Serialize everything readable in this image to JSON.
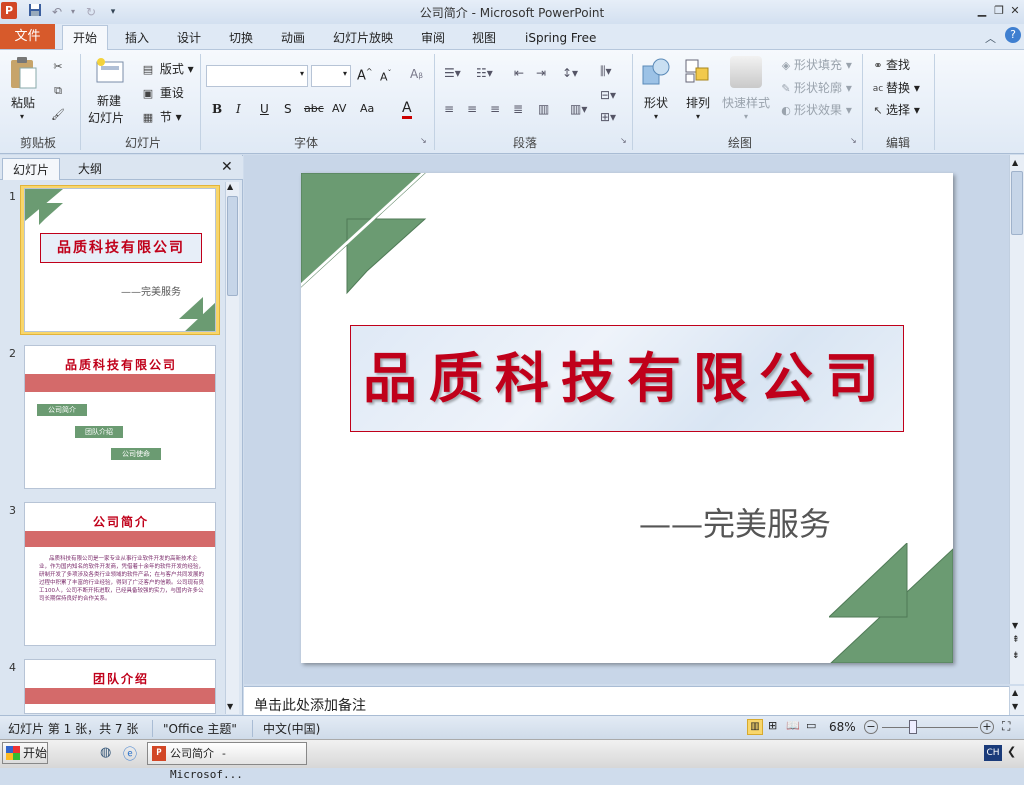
{
  "window": {
    "title": "公司简介 - Microsoft PowerPoint",
    "app_logo": "P"
  },
  "quick_access": {
    "save_icon": "save-icon",
    "undo_icon": "undo-icon",
    "redo_icon": "redo-icon"
  },
  "tabs": [
    "文件",
    "开始",
    "插入",
    "设计",
    "切换",
    "动画",
    "幻灯片放映",
    "审阅",
    "视图",
    "iSpring Free"
  ],
  "ribbon": {
    "clipboard": {
      "paste": "粘贴",
      "label": "剪贴板"
    },
    "slides": {
      "new_slide_1": "新建",
      "new_slide_2": "幻灯片",
      "layout": "版式",
      "reset": "重设",
      "section": "节",
      "label": "幻灯片"
    },
    "font": {
      "label": "字体",
      "bold": "B",
      "italic": "I",
      "underline": "U",
      "shadow": "S",
      "strike": "abc",
      "spacing": "AV",
      "case": "Aa",
      "color": "A"
    },
    "paragraph": {
      "label": "段落"
    },
    "drawing": {
      "shapes": "形状",
      "arrange": "排列",
      "quick_styles": "快速样式",
      "fill": "形状填充",
      "outline": "形状轮廓",
      "effects": "形状效果",
      "label": "绘图"
    },
    "editing": {
      "find": "查找",
      "replace": "替换",
      "select": "选择",
      "label": "编辑"
    }
  },
  "left_panel": {
    "tab_slides": "幻灯片",
    "tab_outline": "大纲",
    "thumbnails": [
      {
        "num": "1",
        "title": "品质科技有限公司",
        "subtitle": "——完美服务"
      },
      {
        "num": "2",
        "title": "品质科技有限公司",
        "items": [
          "公司简介",
          "团队介绍",
          "公司使命"
        ]
      },
      {
        "num": "3",
        "title": "公司简介",
        "body": "品质科技有限公司是一家专业从事行业软件开发的高新技术企业，作为国内知名的软件开发商，凭借着十余年的软件开发的经验，研制开发了多项涉及各类行业领域的软件产品；在与客户共同发展的过程中积累了丰富的行业经验，得到了广泛客户的信赖。公司现有员工100人，公司不断开拓进取，已经具备较强的实力，与国内许多公司长期保持良好的合作关系。"
      },
      {
        "num": "4",
        "title": "团队介绍"
      }
    ]
  },
  "slide": {
    "title": "品质科技有限公司",
    "subtitle": "——完美服务"
  },
  "notes_placeholder": "单击此处添加备注",
  "status": {
    "slide_info": "幻灯片 第 1 张，共 7 张",
    "theme": "\"Office 主题\"",
    "language": "中文(中国)",
    "zoom": "68%"
  },
  "taskbar": {
    "start": "开始",
    "app": "公司简介 - Microsof...",
    "ime": "CH"
  },
  "colors": {
    "accent_green": "#6b9b72",
    "title_red": "#c0001a",
    "file_tab": "#d75a2b"
  }
}
